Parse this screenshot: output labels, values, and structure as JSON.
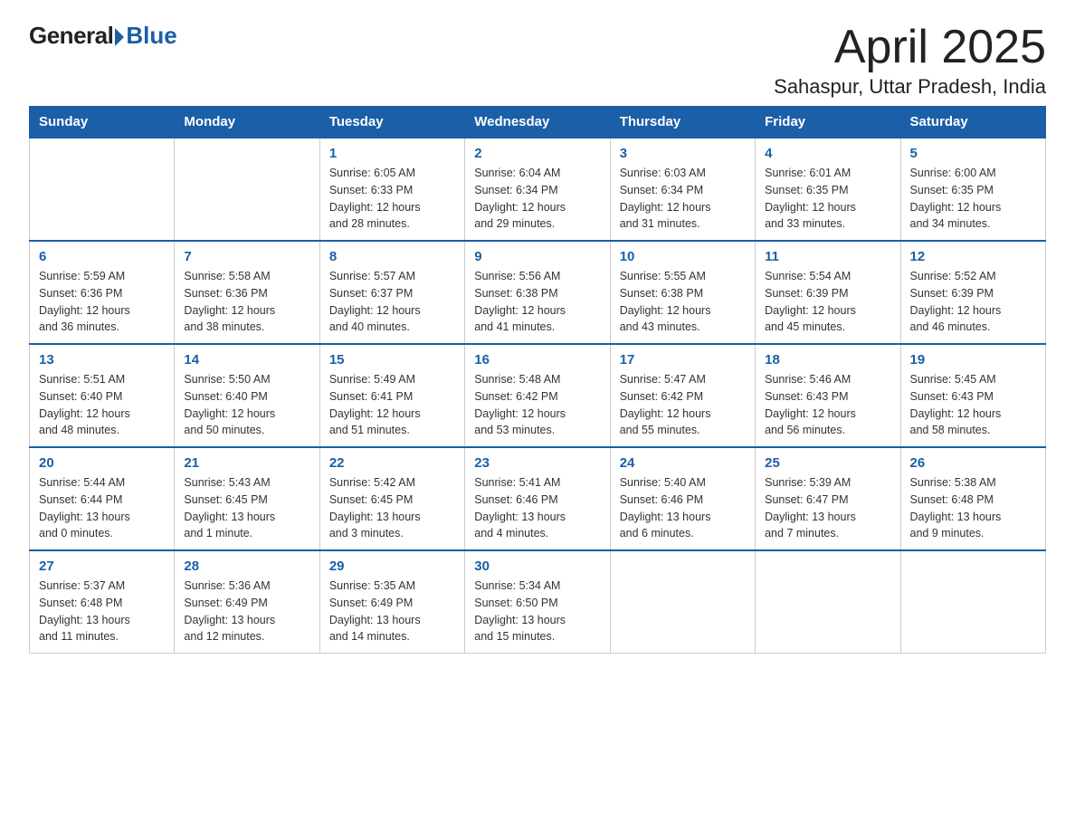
{
  "logo": {
    "general": "General",
    "blue": "Blue"
  },
  "title": "April 2025",
  "location": "Sahaspur, Uttar Pradesh, India",
  "days_of_week": [
    "Sunday",
    "Monday",
    "Tuesday",
    "Wednesday",
    "Thursday",
    "Friday",
    "Saturday"
  ],
  "weeks": [
    [
      {
        "day": "",
        "detail": ""
      },
      {
        "day": "",
        "detail": ""
      },
      {
        "day": "1",
        "detail": "Sunrise: 6:05 AM\nSunset: 6:33 PM\nDaylight: 12 hours\nand 28 minutes."
      },
      {
        "day": "2",
        "detail": "Sunrise: 6:04 AM\nSunset: 6:34 PM\nDaylight: 12 hours\nand 29 minutes."
      },
      {
        "day": "3",
        "detail": "Sunrise: 6:03 AM\nSunset: 6:34 PM\nDaylight: 12 hours\nand 31 minutes."
      },
      {
        "day": "4",
        "detail": "Sunrise: 6:01 AM\nSunset: 6:35 PM\nDaylight: 12 hours\nand 33 minutes."
      },
      {
        "day": "5",
        "detail": "Sunrise: 6:00 AM\nSunset: 6:35 PM\nDaylight: 12 hours\nand 34 minutes."
      }
    ],
    [
      {
        "day": "6",
        "detail": "Sunrise: 5:59 AM\nSunset: 6:36 PM\nDaylight: 12 hours\nand 36 minutes."
      },
      {
        "day": "7",
        "detail": "Sunrise: 5:58 AM\nSunset: 6:36 PM\nDaylight: 12 hours\nand 38 minutes."
      },
      {
        "day": "8",
        "detail": "Sunrise: 5:57 AM\nSunset: 6:37 PM\nDaylight: 12 hours\nand 40 minutes."
      },
      {
        "day": "9",
        "detail": "Sunrise: 5:56 AM\nSunset: 6:38 PM\nDaylight: 12 hours\nand 41 minutes."
      },
      {
        "day": "10",
        "detail": "Sunrise: 5:55 AM\nSunset: 6:38 PM\nDaylight: 12 hours\nand 43 minutes."
      },
      {
        "day": "11",
        "detail": "Sunrise: 5:54 AM\nSunset: 6:39 PM\nDaylight: 12 hours\nand 45 minutes."
      },
      {
        "day": "12",
        "detail": "Sunrise: 5:52 AM\nSunset: 6:39 PM\nDaylight: 12 hours\nand 46 minutes."
      }
    ],
    [
      {
        "day": "13",
        "detail": "Sunrise: 5:51 AM\nSunset: 6:40 PM\nDaylight: 12 hours\nand 48 minutes."
      },
      {
        "day": "14",
        "detail": "Sunrise: 5:50 AM\nSunset: 6:40 PM\nDaylight: 12 hours\nand 50 minutes."
      },
      {
        "day": "15",
        "detail": "Sunrise: 5:49 AM\nSunset: 6:41 PM\nDaylight: 12 hours\nand 51 minutes."
      },
      {
        "day": "16",
        "detail": "Sunrise: 5:48 AM\nSunset: 6:42 PM\nDaylight: 12 hours\nand 53 minutes."
      },
      {
        "day": "17",
        "detail": "Sunrise: 5:47 AM\nSunset: 6:42 PM\nDaylight: 12 hours\nand 55 minutes."
      },
      {
        "day": "18",
        "detail": "Sunrise: 5:46 AM\nSunset: 6:43 PM\nDaylight: 12 hours\nand 56 minutes."
      },
      {
        "day": "19",
        "detail": "Sunrise: 5:45 AM\nSunset: 6:43 PM\nDaylight: 12 hours\nand 58 minutes."
      }
    ],
    [
      {
        "day": "20",
        "detail": "Sunrise: 5:44 AM\nSunset: 6:44 PM\nDaylight: 13 hours\nand 0 minutes."
      },
      {
        "day": "21",
        "detail": "Sunrise: 5:43 AM\nSunset: 6:45 PM\nDaylight: 13 hours\nand 1 minute."
      },
      {
        "day": "22",
        "detail": "Sunrise: 5:42 AM\nSunset: 6:45 PM\nDaylight: 13 hours\nand 3 minutes."
      },
      {
        "day": "23",
        "detail": "Sunrise: 5:41 AM\nSunset: 6:46 PM\nDaylight: 13 hours\nand 4 minutes."
      },
      {
        "day": "24",
        "detail": "Sunrise: 5:40 AM\nSunset: 6:46 PM\nDaylight: 13 hours\nand 6 minutes."
      },
      {
        "day": "25",
        "detail": "Sunrise: 5:39 AM\nSunset: 6:47 PM\nDaylight: 13 hours\nand 7 minutes."
      },
      {
        "day": "26",
        "detail": "Sunrise: 5:38 AM\nSunset: 6:48 PM\nDaylight: 13 hours\nand 9 minutes."
      }
    ],
    [
      {
        "day": "27",
        "detail": "Sunrise: 5:37 AM\nSunset: 6:48 PM\nDaylight: 13 hours\nand 11 minutes."
      },
      {
        "day": "28",
        "detail": "Sunrise: 5:36 AM\nSunset: 6:49 PM\nDaylight: 13 hours\nand 12 minutes."
      },
      {
        "day": "29",
        "detail": "Sunrise: 5:35 AM\nSunset: 6:49 PM\nDaylight: 13 hours\nand 14 minutes."
      },
      {
        "day": "30",
        "detail": "Sunrise: 5:34 AM\nSunset: 6:50 PM\nDaylight: 13 hours\nand 15 minutes."
      },
      {
        "day": "",
        "detail": ""
      },
      {
        "day": "",
        "detail": ""
      },
      {
        "day": "",
        "detail": ""
      }
    ]
  ]
}
